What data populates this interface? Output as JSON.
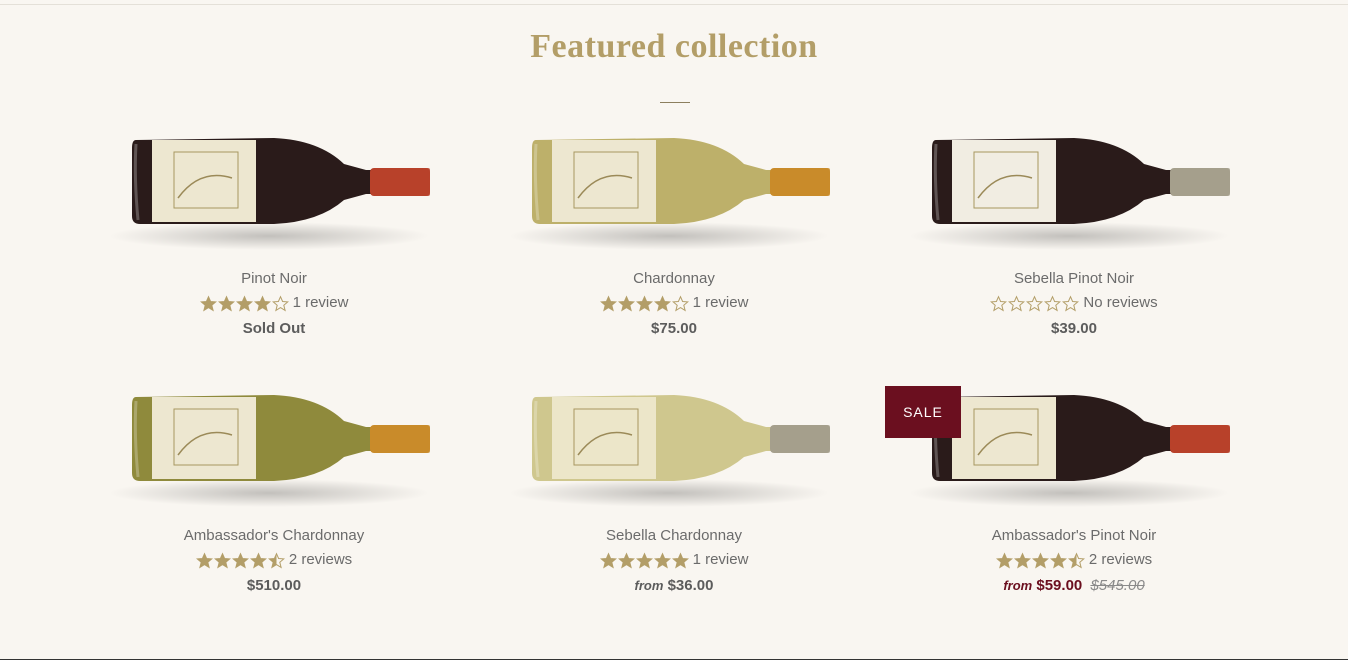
{
  "section": {
    "title": "Featured collection"
  },
  "products": [
    {
      "name": "Pinot Noir",
      "rating": 4,
      "review_text": "1 review",
      "price_text": "Sold Out",
      "capsule": "#b8412a",
      "glass": "#2a1b1a",
      "label": "#ede7d0",
      "sale": false
    },
    {
      "name": "Chardonnay",
      "rating": 4,
      "review_text": "1 review",
      "price_text": "$75.00",
      "capsule": "#c98b2a",
      "glass": "#bdb06a",
      "label": "#ede7d0",
      "sale": false
    },
    {
      "name": "Sebella Pinot Noir",
      "rating": 0,
      "review_text": "No reviews",
      "price_text": "$39.00",
      "capsule": "#a59f8c",
      "glass": "#2a1b1a",
      "label": "#f1ede2",
      "sale": false
    },
    {
      "name": "Ambassador's Chardonnay",
      "rating": 4.5,
      "review_text": "2 reviews",
      "price_text": "$510.00",
      "capsule": "#c98b2a",
      "glass": "#8f8a3c",
      "label": "#ede7d0",
      "sale": false
    },
    {
      "name": "Sebella Chardonnay",
      "rating": 5,
      "review_text": "1 review",
      "from_label": "from",
      "price_text": "$36.00",
      "capsule": "#a59f8c",
      "glass": "#cfc78e",
      "label": "#ece6c9",
      "sale": false
    },
    {
      "name": "Ambassador's Pinot Noir",
      "rating": 4.5,
      "review_text": "2 reviews",
      "from_label": "from",
      "price_text": "$59.00",
      "compare_text": "$545.00",
      "capsule": "#b8412a",
      "glass": "#2a1b1a",
      "label": "#ede7d0",
      "sale": true,
      "badge": "SALE"
    }
  ],
  "colors": {
    "accent": "#b39e68",
    "sale": "#6b0f1f",
    "star": "#b39e68"
  }
}
